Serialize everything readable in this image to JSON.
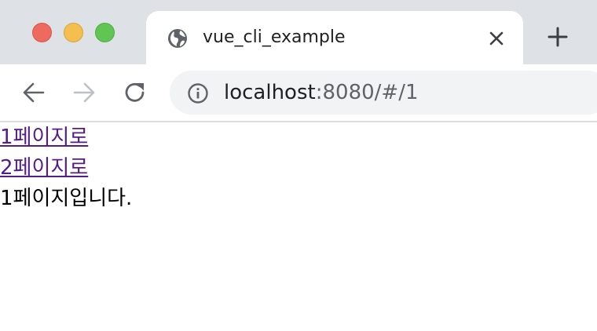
{
  "window": {
    "controls": {
      "close_color": "#ee6a5e",
      "minimize_color": "#f5bf4f",
      "maximize_color": "#61c554"
    }
  },
  "tab": {
    "icon": "globe-icon",
    "title": "vue_cli_example",
    "close_icon": "close-icon"
  },
  "new_tab_icon": "plus-icon",
  "toolbar": {
    "back_icon": "arrow-left-icon",
    "forward_icon": "arrow-right-icon",
    "forward_enabled": false,
    "reload_icon": "reload-icon"
  },
  "omnibox": {
    "icon": "info-icon",
    "url_host": "localhost",
    "url_path": ":8080/#/1"
  },
  "page": {
    "links": [
      {
        "label": "1페이지로"
      },
      {
        "label": "2페이지로"
      }
    ],
    "body_text": "1페이지입니다."
  },
  "colors": {
    "visited_link": "#551a8b",
    "tabstrip_bg": "#dee1e6",
    "omnibox_bg": "#f1f3f4"
  }
}
